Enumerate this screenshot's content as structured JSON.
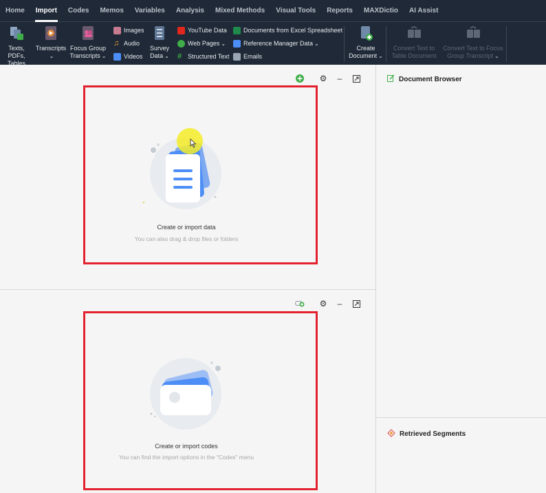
{
  "tabs": [
    "Home",
    "Import",
    "Codes",
    "Memos",
    "Variables",
    "Analysis",
    "Mixed Methods",
    "Visual Tools",
    "Reports",
    "MAXDictio",
    "AI Assist"
  ],
  "active_tab": "Import",
  "ribbon": {
    "texts_pdfs_tables": [
      "Texts, PDFs,",
      "Tables"
    ],
    "transcripts": "Transcripts",
    "focus_group": [
      "Focus Group",
      "Transcripts"
    ],
    "images": "Images",
    "audio": "Audio",
    "videos": "Videos",
    "survey_data": [
      "Survey",
      "Data"
    ],
    "youtube_data": "YouTube Data",
    "web_pages": "Web Pages",
    "structured_text": "Structured Text",
    "documents_from_excel": "Documents from Excel Spreadsheet",
    "reference_manager_data": "Reference Manager Data",
    "emails": "Emails",
    "create_document": [
      "Create",
      "Document"
    ],
    "convert_text_to_table": [
      "Convert Text to",
      "Table Document"
    ],
    "convert_text_to_focus": [
      "Convert Text to Focus",
      "Group Transcript"
    ]
  },
  "documents_panel": {
    "empty_title": "Create or import data",
    "empty_subtitle": "You can also drag & drop files or folders"
  },
  "codes_panel": {
    "empty_title": "Create or import codes",
    "empty_subtitle": "You can find the import options in the \"Codes\" menu"
  },
  "document_browser": {
    "title": "Document Browser"
  },
  "retrieved_segments": {
    "title": "Retrieved Segments"
  },
  "colors": {
    "ribbon_bg": "#1f2937",
    "highlight_red": "#e3212e",
    "accent_blue": "#4c8df6",
    "add_green": "#3fae49"
  }
}
